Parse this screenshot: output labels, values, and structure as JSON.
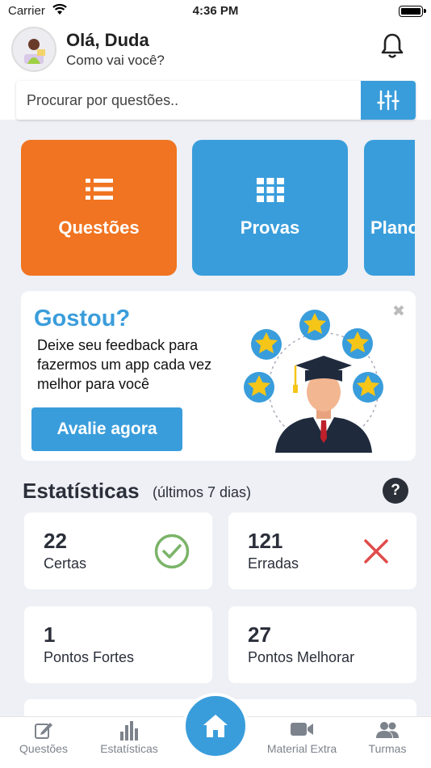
{
  "status": {
    "carrier": "Carrier",
    "time": "4:36 PM"
  },
  "header": {
    "greeting": "Olá, Duda",
    "subgreeting": "Como vai você?"
  },
  "search": {
    "placeholder": "Procurar por questões.."
  },
  "cards": [
    {
      "label": "Questões",
      "color": "#f07421",
      "icon": "list-icon"
    },
    {
      "label": "Provas",
      "color": "#3a9ddb",
      "icon": "grid-icon"
    },
    {
      "label": "Planos",
      "color": "#3a9ddb"
    }
  ],
  "feedback": {
    "title": "Gostou?",
    "text": "Deixe seu feedback para fazermos um app cada vez melhor para você",
    "button": "Avalie agora"
  },
  "stats": {
    "title": "Estatísticas",
    "subtitle": "(últimos 7 dias)",
    "help": "?",
    "items": [
      {
        "value": "22",
        "label": "Certas",
        "icon": "check-icon",
        "color": "#7bb469"
      },
      {
        "value": "121",
        "label": "Erradas",
        "icon": "cross-icon",
        "color": "#e04b4b"
      },
      {
        "value": "1",
        "label": "Pontos Fortes"
      },
      {
        "value": "27",
        "label": "Pontos Melhorar"
      }
    ]
  },
  "tabs": [
    {
      "label": "Questões",
      "icon": "edit-icon"
    },
    {
      "label": "Estatísticas",
      "icon": "bar-chart-icon"
    },
    {
      "label": "",
      "icon": "home-icon"
    },
    {
      "label": "Material Extra",
      "icon": "video-icon"
    },
    {
      "label": "Turmas",
      "icon": "group-icon"
    }
  ],
  "colors": {
    "accent": "#3a9ddb",
    "orange": "#f07421",
    "background": "#eef0f5",
    "dark": "#2b2f3a"
  }
}
